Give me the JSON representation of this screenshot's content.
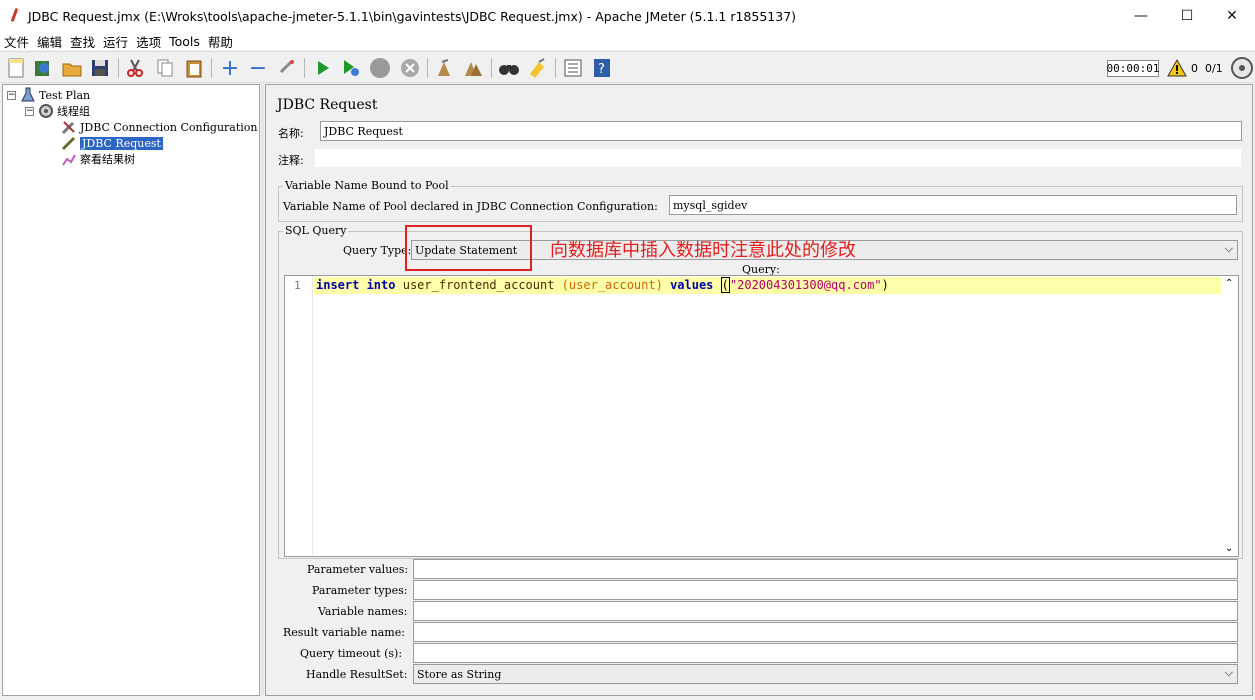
{
  "window": {
    "title": "JDBC Request.jmx (E:\\Wroks\\tools\\apache-jmeter-5.1.1\\bin\\gavintests\\JDBC Request.jmx) - Apache JMeter (5.1.1 r1855137)",
    "minimize": "—",
    "maximize": "☐",
    "close": "✕"
  },
  "menu": [
    "文件",
    "编辑",
    "查找",
    "运行",
    "选项",
    "Tools",
    "帮助"
  ],
  "toolbar": {
    "timer": "00:00:01",
    "warning_count": "0",
    "threads": "0/1"
  },
  "tree": {
    "test_plan": "Test Plan",
    "thread_group": "线程组",
    "jdbc_config": "JDBC Connection Configuration",
    "jdbc_request": "JDBC Request",
    "result_tree": "察看结果树"
  },
  "panel": {
    "title": "JDBC Request",
    "name_label": "名称:",
    "name_value": "JDBC Request",
    "comment_label": "注释:",
    "comment_value": "",
    "pool_group_title": "Variable Name Bound to Pool",
    "pool_label": "Variable Name of Pool declared in JDBC Connection Configuration:",
    "pool_value": "mysql_sgidev",
    "sql_group_title": "SQL Query",
    "query_type_label": "Query Type:",
    "query_type_value": "Update Statement",
    "query_label": "Query:",
    "line_number": "1",
    "code": {
      "kw1": "insert into",
      "table": "user_frontend_account",
      "cols": "(user_account)",
      "kw2": "values",
      "paren_open": "(",
      "str": "\"202004301300@qq.com\"",
      "paren_close": ")"
    },
    "params": [
      {
        "label": "Parameter values:",
        "value": ""
      },
      {
        "label": "Parameter types:",
        "value": ""
      },
      {
        "label": "Variable names:",
        "value": ""
      },
      {
        "label": "Result variable name:",
        "value": ""
      },
      {
        "label": "Query timeout (s):",
        "value": ""
      },
      {
        "label": "Handle ResultSet:",
        "value": "Store as String"
      }
    ]
  },
  "annotation": {
    "text": "向数据库中插入数据时注意此处的修改",
    "color": "#e02020"
  }
}
